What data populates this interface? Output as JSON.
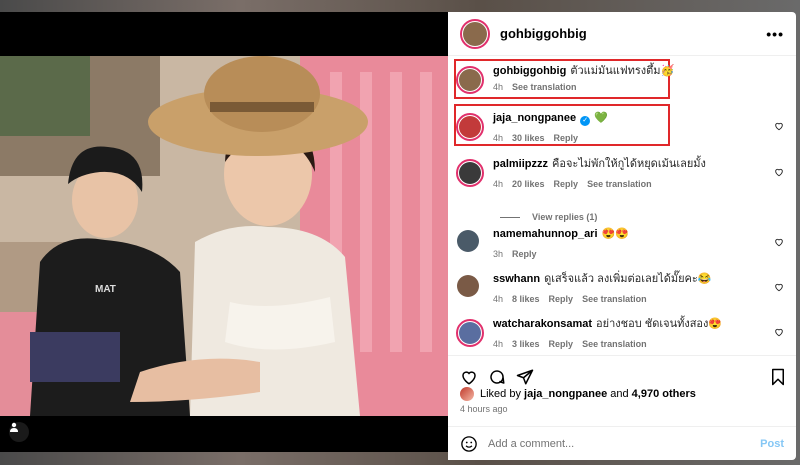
{
  "post": {
    "author": "gohbiggohbig",
    "more_label": "•••",
    "likes_prefix": "Liked by",
    "liked_by_user": "jaja_nongpanee",
    "likes_conj": "and",
    "likes_others": "4,970 others",
    "time_ago": "4 hours ago"
  },
  "comments": [
    {
      "user": "gohbiggohbig",
      "text": "ตัวแม่มันแฟทรงตึ้ม🥳",
      "time": "4h",
      "likes": "",
      "reply": "",
      "translate": "See translation",
      "highlighted": true,
      "avatar_color": "#8a6a4c"
    },
    {
      "user": "jaja_nongpanee",
      "text": "💚",
      "time": "4h",
      "likes": "30 likes",
      "reply": "Reply",
      "translate": "",
      "verified": true,
      "highlighted": true,
      "avatar_color": "#c23a3a"
    },
    {
      "user": "palmiipzzz",
      "text": "คือจะไม่พักให้กูได้หยุดเม้นเลยมั้ง",
      "time": "4h",
      "likes": "20 likes",
      "reply": "Reply",
      "translate": "See translation",
      "avatar_color": "#3a3a3a"
    },
    {
      "user": "namemahunnop_ari",
      "text": "😍😍",
      "time": "3h",
      "likes": "",
      "reply": "Reply",
      "translate": "",
      "avatar_color": "#4a5a68"
    },
    {
      "user": "sswhann",
      "text": "ดูเสร็จแล้ว ลงเพิ่มต่อเลยได้มั๊ยคะ😂",
      "time": "4h",
      "likes": "8 likes",
      "reply": "Reply",
      "translate": "See translation",
      "avatar_color": "#7a5a46"
    },
    {
      "user": "watcharakonsamat",
      "text": "อย่างชอบ ชัดเจนทั้งสอง😍",
      "time": "4h",
      "likes": "3 likes",
      "reply": "Reply",
      "translate": "See translation",
      "avatar_color": "#5a6ea0"
    }
  ],
  "view_replies": "View replies (1)",
  "composer": {
    "placeholder": "Add a comment...",
    "post_label": "Post"
  },
  "colors": {
    "highlight": "#e0282a",
    "link": "#0095f6",
    "post_disabled": "#85c7f5"
  },
  "icons": [
    "heart-icon",
    "comment-icon",
    "share-icon",
    "bookmark-icon",
    "emoji-icon",
    "more-icon",
    "user-tag-icon",
    "verified-icon"
  ]
}
